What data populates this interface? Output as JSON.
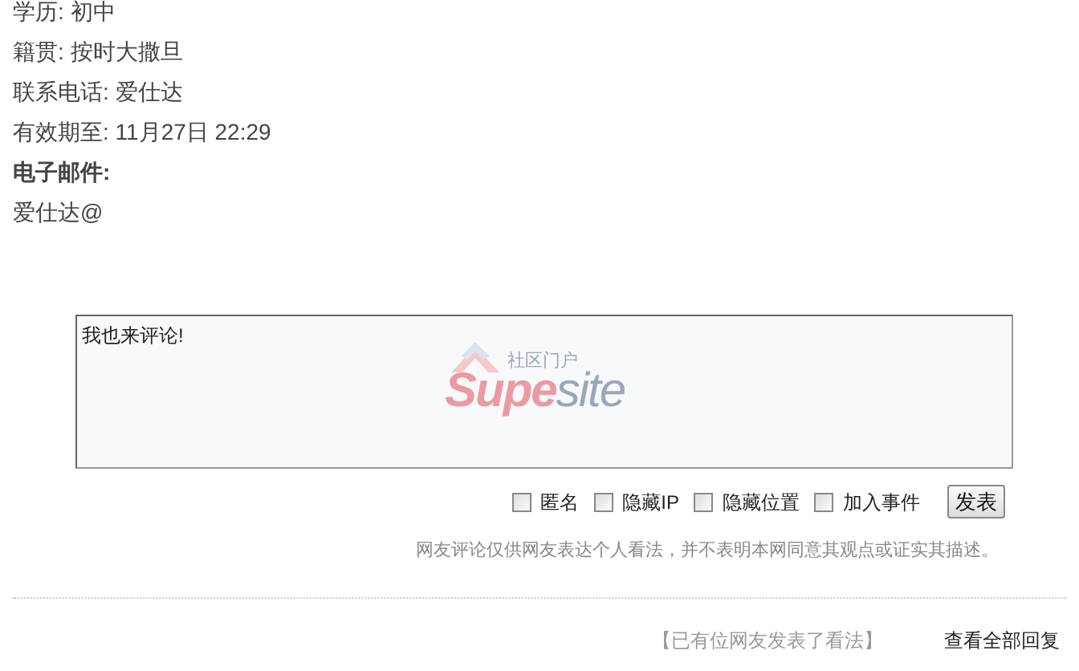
{
  "profile": [
    {
      "label": "学历:",
      "value": "初中"
    },
    {
      "label": "籍贯:",
      "value": "按时大撒旦"
    },
    {
      "label": "联系电话:",
      "value": "爱仕达"
    },
    {
      "label": "有效期至:",
      "value": "11月27日 22:29"
    }
  ],
  "email": {
    "label": "电子邮件:",
    "value": "爱仕达@"
  },
  "comment_box": {
    "value": "我也来评论!",
    "logo_tagline": "社区门户",
    "logo_name_a": "Supe",
    "logo_name_b": "site"
  },
  "options": [
    {
      "label": "匿名",
      "checked": false
    },
    {
      "label": "隐藏IP",
      "checked": false
    },
    {
      "label": "隐藏位置",
      "checked": false
    },
    {
      "label": "加入事件",
      "checked": false
    }
  ],
  "submit": "发表",
  "notice": "网友评论仅供网友表达个人看法，并不表明本网同意其观点或证实其描述。",
  "footer": {
    "count_text": "【已有位网友发表了看法】",
    "view_all": "查看全部回复"
  }
}
